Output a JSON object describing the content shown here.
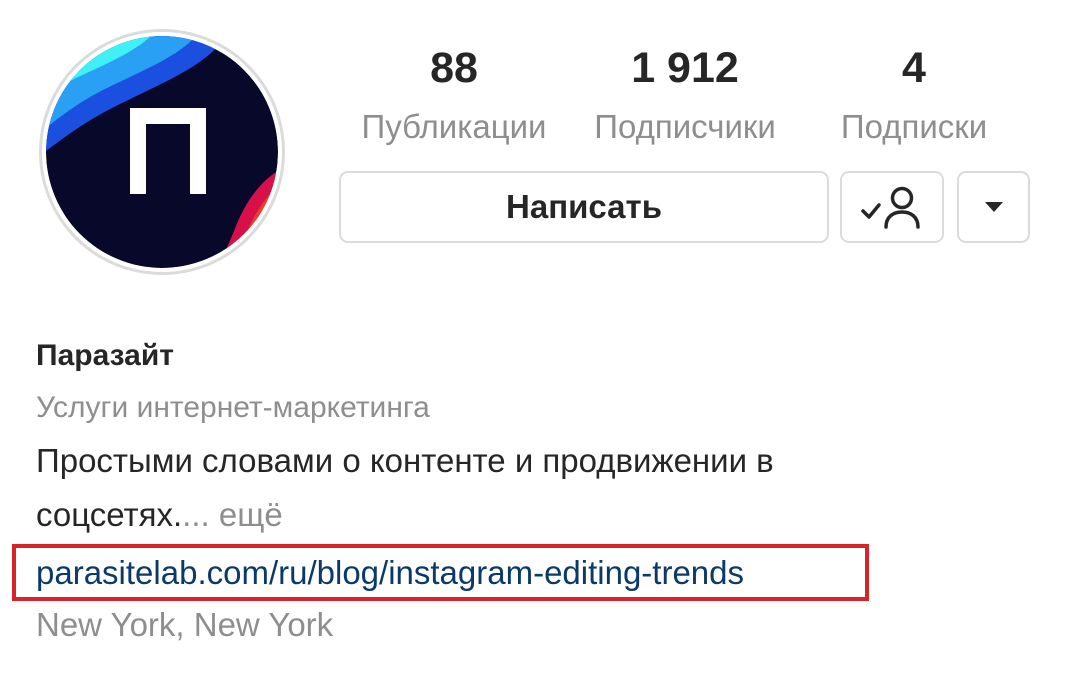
{
  "profile": {
    "avatar_icon": "brand-logo-icon",
    "stats": {
      "posts_value": "88",
      "posts_label": "Публикации",
      "followers_value": "1 912",
      "followers_label": "Подписчики",
      "following_value": "4",
      "following_label": "Подписки"
    },
    "buttons": {
      "message_label": "Написать",
      "following_icon": "person-check-icon",
      "more_icon": "caret-down-icon"
    },
    "bio": {
      "name": "Паразайт",
      "category": "Услуги интернет-маркетинга",
      "text": "Простыми словами о контенте и продвижении в соцсетях.",
      "more_label": "... ещё",
      "link": "parasitelab.com/ru/blog/instagram-editing-trends",
      "location": "New York, New York"
    }
  },
  "colors": {
    "text_primary": "#262626",
    "text_secondary": "#8e8e8e",
    "link": "#0b3a69",
    "highlight_border": "#d9232a",
    "button_border": "#dbdbdb"
  }
}
